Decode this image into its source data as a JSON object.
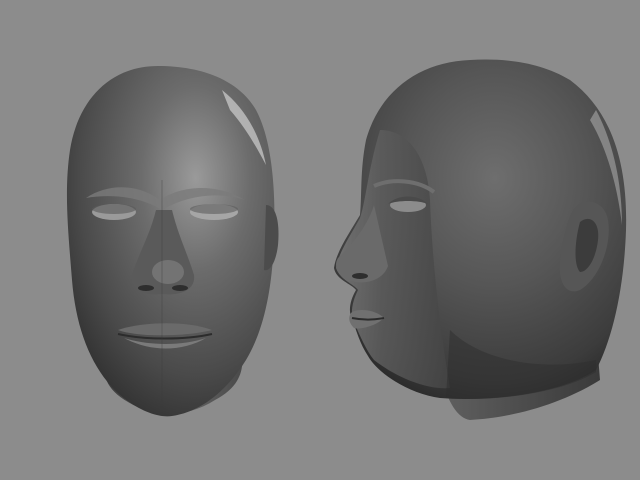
{
  "scene": {
    "background_color": "#8c8c8c",
    "subject_color": "#5a5a5a",
    "highlight_color": "#bdbdbd",
    "shadow_color": "#2e2e2e",
    "views": [
      {
        "name": "front-view",
        "description_label": ""
      },
      {
        "name": "three-quarter-view",
        "description_label": ""
      }
    ]
  }
}
